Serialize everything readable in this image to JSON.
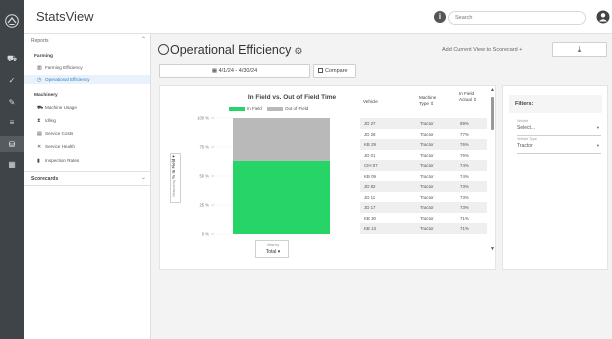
{
  "app": {
    "title": "StatsView"
  },
  "search": {
    "placeholder": "Search"
  },
  "sidebar": {
    "reports_label": "Reports",
    "farming_label": "Farming",
    "farming_items": [
      {
        "label": "Farming Efficiency"
      },
      {
        "label": "Operational Efficiency"
      }
    ],
    "machinery_label": "Machinery",
    "machinery_items": [
      {
        "label": "Machine Usage"
      },
      {
        "label": "Idling"
      },
      {
        "label": "Service Costs"
      },
      {
        "label": "Service Health"
      },
      {
        "label": "Inspection Rates"
      }
    ],
    "scorecards_label": "Scorecards"
  },
  "page": {
    "title": "Operational Efficiency",
    "add_scorecard": "Add Current View to Scorecard +",
    "date_range": "4/1/24 - 4/30/24",
    "compare_label": "Compare"
  },
  "chart": {
    "measure_label": "Measure by",
    "measure_value": "% In Field",
    "view_by_label": "View by",
    "view_by_value": "Total",
    "legend": [
      {
        "label": "In Field",
        "color": "#27d468"
      },
      {
        "label": "Out of Field",
        "color": "#b9b9b9"
      }
    ]
  },
  "chart_data": {
    "type": "bar",
    "title": "In Field vs. Out of Field Time",
    "xlabel": "",
    "ylabel": "% In Field",
    "categories": [
      "Total"
    ],
    "series": [
      {
        "name": "In Field",
        "values": [
          63
        ]
      },
      {
        "name": "Out of Field",
        "values": [
          37
        ]
      }
    ],
    "ylim": [
      0,
      100
    ],
    "y_ticks": [
      "100 %",
      "75 %",
      "50 %",
      "25 %",
      "0 %"
    ],
    "stacked": true,
    "grid": false
  },
  "table": {
    "headers": [
      "Vehicle",
      "Machine Type",
      "In Field Actual"
    ],
    "rows": [
      {
        "vehicle": "JD 27",
        "type": "Tractor",
        "actual": "89%"
      },
      {
        "vehicle": "JD 28",
        "type": "Tractor",
        "actual": "77%"
      },
      {
        "vehicle": "KB 29",
        "type": "Tractor",
        "actual": "76%"
      },
      {
        "vehicle": "JD 01",
        "type": "Tractor",
        "actual": "76%"
      },
      {
        "vehicle": "CIH 07",
        "type": "Tractor",
        "actual": "74%"
      },
      {
        "vehicle": "KB 09",
        "type": "Tractor",
        "actual": "74%"
      },
      {
        "vehicle": "JD 82",
        "type": "Tractor",
        "actual": "73%"
      },
      {
        "vehicle": "JD 11",
        "type": "Tractor",
        "actual": "73%"
      },
      {
        "vehicle": "JD 17",
        "type": "Tractor",
        "actual": "73%"
      },
      {
        "vehicle": "KB 30",
        "type": "Tractor",
        "actual": "71%"
      },
      {
        "vehicle": "KB 13",
        "type": "Tractor",
        "actual": "71%"
      }
    ]
  },
  "filters": {
    "title": "Filters:",
    "vehicle": {
      "label": "Vehicle",
      "value": "Select..."
    },
    "vehicle_type": {
      "label": "Vehicle Type",
      "value": "Tractor"
    }
  },
  "colors": {
    "accent": "#2f7cc1",
    "rail": "#3f4448",
    "in_field": "#27d468",
    "out_field": "#b9b9b9"
  }
}
